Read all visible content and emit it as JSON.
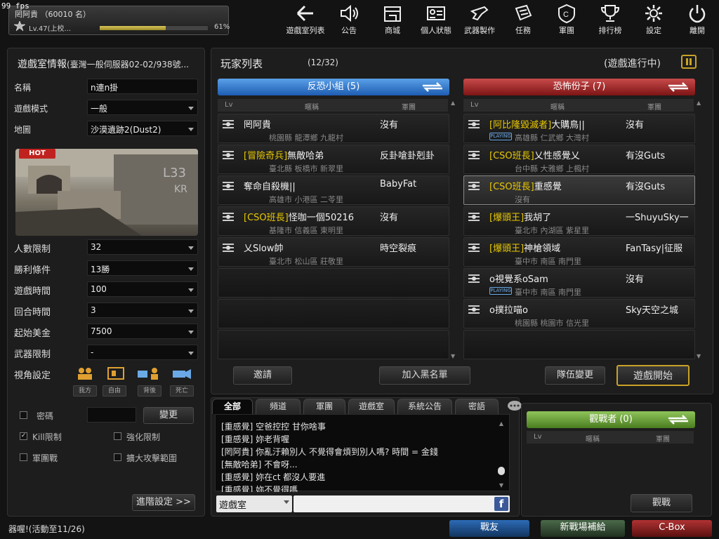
{
  "fps": "99 fps",
  "user": {
    "name": "罔阿貴 （60010 名）",
    "level": "Lv.47(上校...",
    "exp_fraction": 0.61,
    "exp_pct": "61%"
  },
  "nav": [
    {
      "label": "遊戲室列表",
      "icon": "back-arrow-icon"
    },
    {
      "label": "公告",
      "icon": "speaker-icon"
    },
    {
      "label": "商城",
      "icon": "shop-icon"
    },
    {
      "label": "個人狀態",
      "icon": "id-card-icon"
    },
    {
      "label": "武器製作",
      "icon": "weapon-icon"
    },
    {
      "label": "任務",
      "icon": "mission-icon"
    },
    {
      "label": "軍團",
      "icon": "clan-icon"
    },
    {
      "label": "排行榜",
      "icon": "trophy-icon"
    },
    {
      "label": "設定",
      "icon": "gear-icon"
    },
    {
      "label": "離開",
      "icon": "power-icon"
    }
  ],
  "room": {
    "title": "遊戲室情報",
    "server": "(臺灣一般伺服器02-02/938號...",
    "fields": [
      {
        "label": "名稱",
        "value": "n連n掛"
      },
      {
        "label": "遊戲模式",
        "value": "一般"
      },
      {
        "label": "地圖",
        "value": "沙漠遺跡2(Dust2)"
      }
    ],
    "hot": "HOT",
    "settings": [
      {
        "label": "人數限制",
        "value": "32"
      },
      {
        "label": "勝利條件",
        "value": "13勝"
      },
      {
        "label": "遊戲時間",
        "value": "100"
      },
      {
        "label": "回合時間",
        "value": "3"
      },
      {
        "label": "起始美金",
        "value": "7500"
      },
      {
        "label": "武器限制",
        "value": "-"
      }
    ],
    "view_label": "視角設定",
    "view_buttons": [
      "我方",
      "自由",
      "背後",
      "死亡"
    ],
    "password_label": "密碼",
    "change_label": "變更",
    "checks": [
      {
        "label": "Kill限制",
        "checked": true
      },
      {
        "label": "強化限制",
        "checked": false
      },
      {
        "label": "軍團戰",
        "checked": false
      },
      {
        "label": "擴大攻擊範圍",
        "checked": false
      }
    ],
    "advanced": "進階設定 >>"
  },
  "players": {
    "title": "玩家列表",
    "count": "(12/32)",
    "status": "(遊戲進行中)",
    "columns": [
      "Lv",
      "暱稱",
      "軍團"
    ],
    "teams": [
      {
        "name": "反恐小組 (5)",
        "rows": [
          {
            "title": "",
            "name": "罔阿貴",
            "clan": "沒有",
            "loc": "桃園縣 龍潭鄉 九龍村",
            "playing": false
          },
          {
            "title": "[冒險奇兵]",
            "name": "無敵哈弟",
            "clan": "反卦嗆卦剋卦",
            "loc": "臺北縣 板橋市 新翠里",
            "playing": false
          },
          {
            "title": "",
            "name": "奪命自殺機||",
            "clan": "BabyFat",
            "loc": "高雄市 小港區 二苓里",
            "playing": false
          },
          {
            "title": "[CSO班長]",
            "name": "怪咖一個50216",
            "clan": "沒有",
            "loc": "基隆市 信義區 東明里",
            "playing": false
          },
          {
            "title": "",
            "name": "乂Slow帥",
            "clan": "時空裂痕",
            "loc": "臺北市 松山區 莊敬里",
            "playing": false
          }
        ]
      },
      {
        "name": "恐怖份子 (7)",
        "rows": [
          {
            "title": "[阿比隆毀滅者]",
            "name": "大購鳥||",
            "clan": "沒有",
            "loc": "高雄縣 仁武鄉 大灣村",
            "playing": true
          },
          {
            "title": "[CSO班長]",
            "name": "乂性感覺乂",
            "clan": "有沒Guts",
            "loc": "台中縣 大雅鄉 上楓村",
            "playing": false
          },
          {
            "title": "[CSO班長]",
            "name": "重感覺",
            "clan": "有沒Guts",
            "loc": "沒有",
            "playing": false
          },
          {
            "title": "[爆頭王]",
            "name": "我胡了",
            "clan": "一ShuyuSky一",
            "loc": "臺北市 內湖區 紫星里",
            "playing": false
          },
          {
            "title": "[爆頭王]",
            "name": "神槍領域",
            "clan": "FanTasy|征服",
            "loc": "臺中市 南區 南門里",
            "playing": false
          },
          {
            "title": "",
            "name": "o視覺系oSam",
            "clan": "沒有",
            "loc": "臺中市 南區 南門里",
            "playing": true
          },
          {
            "title": "",
            "name": "o撲拉喵o",
            "clan": "Sky天空之城",
            "loc": "桃園縣 桃園市 信光里",
            "playing": false
          }
        ]
      }
    ],
    "playing_label": "PLAYING",
    "buttons": [
      "邀請",
      "加入黑名單",
      "隊伍變更",
      "遊戲開始"
    ]
  },
  "chat": {
    "tabs": [
      "全部",
      "頻道",
      "軍團",
      "遊戲室",
      "系統公告",
      "密語"
    ],
    "lines": [
      "[重感覺] 空爸控控 甘你啥事",
      "[重感覺] 妳老背喔",
      "[罔阿貴] 你亂汙賴別人 不覺得會煩到別人嗎? 時間 = 金錢",
      "[無敵哈弟] 不會呀...",
      "[重感覺] 妳在ct 都沒人要進",
      "[重感覺] 妳不覺得嗎"
    ],
    "channel": "遊戲室",
    "input_placeholder": ""
  },
  "spectators": {
    "header": "觀戰者 (0)",
    "columns": [
      "Lv",
      "暱稱",
      "軍團"
    ],
    "button": "觀戰"
  },
  "footer": {
    "notice": "器喔!(活動至11/26)",
    "buttons": [
      "戰友",
      "新戰場補給",
      "C-Box"
    ]
  },
  "colors": {
    "ct": "#2d74c8",
    "tr": "#a32626",
    "title_yellow": "#e8c800",
    "spectator": "#6aa23a"
  }
}
